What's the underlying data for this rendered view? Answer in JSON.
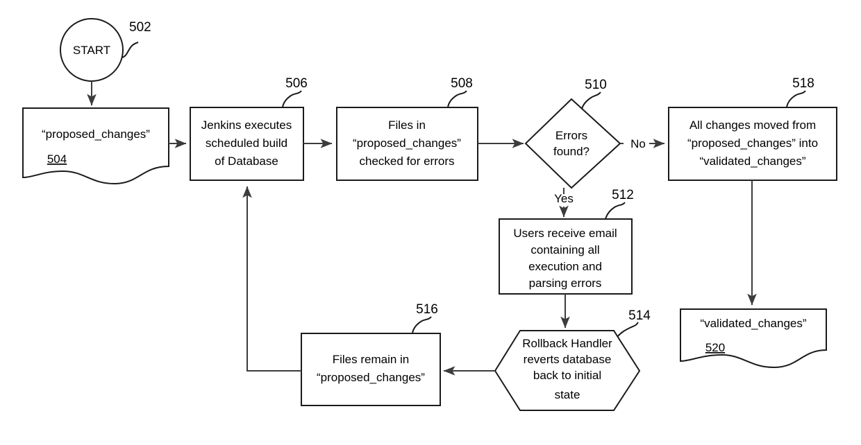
{
  "diagram": {
    "title": "Database change validation flowchart",
    "background_color": "#ffffff",
    "line_color": "#3c3c3c",
    "shape_stroke_color": "#1a1a1a",
    "text_color": "#000000"
  },
  "nodes": {
    "start": {
      "ref": "502",
      "label": "START",
      "shape": "circle"
    },
    "proposed_changes_doc": {
      "ref": "504",
      "label": "“proposed_changes”",
      "shape": "document"
    },
    "jenkins_build": {
      "ref": "506",
      "shape": "process",
      "lines": [
        "Jenkins executes",
        "scheduled build",
        "of Database"
      ]
    },
    "files_checked": {
      "ref": "508",
      "shape": "process",
      "lines": [
        "Files in",
        "“proposed_changes”",
        "checked for errors"
      ]
    },
    "errors_found": {
      "ref": "510",
      "shape": "decision",
      "lines": [
        "Errors",
        "found?"
      ]
    },
    "users_email": {
      "ref": "512",
      "shape": "process",
      "lines": [
        "Users receive email",
        "containing all",
        "execution and",
        "parsing errors"
      ]
    },
    "rollback_handler": {
      "ref": "514",
      "shape": "hexagon",
      "lines": [
        "Rollback Handler",
        "reverts database",
        "back to initial",
        "state"
      ]
    },
    "files_remain": {
      "ref": "516",
      "shape": "process",
      "lines": [
        "Files remain in",
        "“proposed_changes”"
      ]
    },
    "all_changes_moved": {
      "ref": "518",
      "shape": "process",
      "lines": [
        "All changes moved from",
        "“proposed_changes” into",
        "“validated_changes”"
      ]
    },
    "validated_changes_doc": {
      "ref": "520",
      "label": "“validated_changes”",
      "shape": "document"
    }
  },
  "edge_labels": {
    "no": "No",
    "yes": "Yes"
  }
}
